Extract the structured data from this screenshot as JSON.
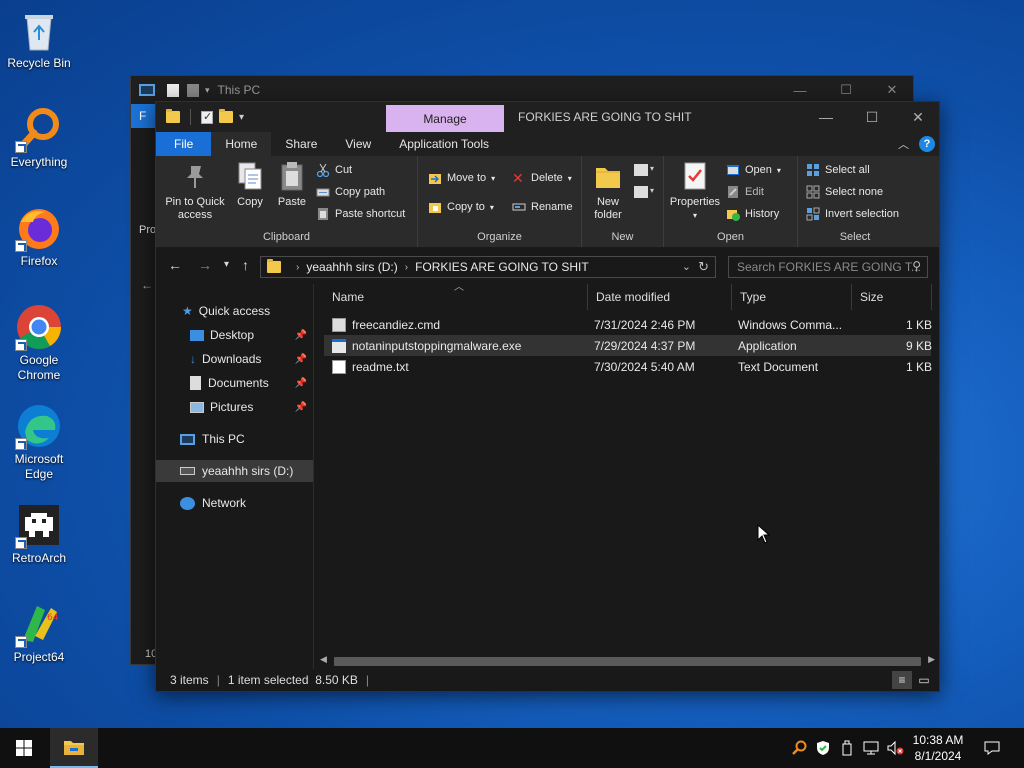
{
  "desktop": {
    "icons": [
      {
        "label": "Recycle Bin",
        "icon": "recycle-bin-icon"
      },
      {
        "label": "Everything",
        "icon": "everything-search-icon"
      },
      {
        "label": "Firefox",
        "icon": "firefox-icon"
      },
      {
        "label": "Google Chrome",
        "icon": "chrome-icon"
      },
      {
        "label": "Microsoft Edge",
        "icon": "edge-icon"
      },
      {
        "label": "RetroArch",
        "icon": "retroarch-icon"
      },
      {
        "label": "Project64",
        "icon": "project64-icon"
      }
    ]
  },
  "back_window": {
    "title": "This PC",
    "tab_file": "F",
    "side_text_1": "Pro",
    "status_fragment": "10"
  },
  "window": {
    "title": "FORKIES ARE GOING TO SHIT",
    "context_tab": "Manage",
    "tabs": [
      "File",
      "Home",
      "Share",
      "View",
      "Application Tools"
    ],
    "active_tab": "Home"
  },
  "ribbon": {
    "clipboard": {
      "label": "Clipboard",
      "pin": "Pin to Quick access",
      "copy": "Copy",
      "paste": "Paste",
      "cut": "Cut",
      "copy_path": "Copy path",
      "paste_shortcut": "Paste shortcut"
    },
    "organize": {
      "label": "Organize",
      "move_to": "Move to",
      "copy_to": "Copy to",
      "delete": "Delete",
      "rename": "Rename"
    },
    "new": {
      "label": "New",
      "new_folder": "New folder"
    },
    "open": {
      "label": "Open",
      "properties": "Properties",
      "open": "Open",
      "edit": "Edit",
      "history": "History"
    },
    "select": {
      "label": "Select",
      "select_all": "Select all",
      "select_none": "Select none",
      "invert": "Invert selection"
    }
  },
  "address": {
    "crumbs": [
      "yeaahhh sirs (D:)",
      "FORKIES ARE GOING TO SHIT"
    ],
    "search_placeholder": "Search FORKIES ARE GOING T..."
  },
  "navpane": {
    "quick_access": "Quick access",
    "items": [
      "Desktop",
      "Downloads",
      "Documents",
      "Pictures"
    ],
    "this_pc": "This PC",
    "drive": "yeaahhh sirs (D:)",
    "network": "Network"
  },
  "columns": [
    "Name",
    "Date modified",
    "Type",
    "Size"
  ],
  "files": [
    {
      "name": "freecandiez.cmd",
      "date": "7/31/2024 2:46 PM",
      "type": "Windows Comma...",
      "size": "1 KB",
      "icon": "cmd-file-icon"
    },
    {
      "name": "notaninputstoppingmalware.exe",
      "date": "7/29/2024 4:37 PM",
      "type": "Application",
      "size": "9 KB",
      "icon": "exe-file-icon"
    },
    {
      "name": "readme.txt",
      "date": "7/30/2024 5:40 AM",
      "type": "Text Document",
      "size": "1 KB",
      "icon": "txt-file-icon"
    }
  ],
  "status": {
    "count": "3 items",
    "selected": "1 item selected  8.50 KB"
  },
  "taskbar": {
    "time": "10:38 AM",
    "date": "8/1/2024"
  },
  "colors": {
    "accent": "#1a6fd6",
    "manage_tab": "#d9b3ef",
    "folder": "#f2c94c"
  }
}
